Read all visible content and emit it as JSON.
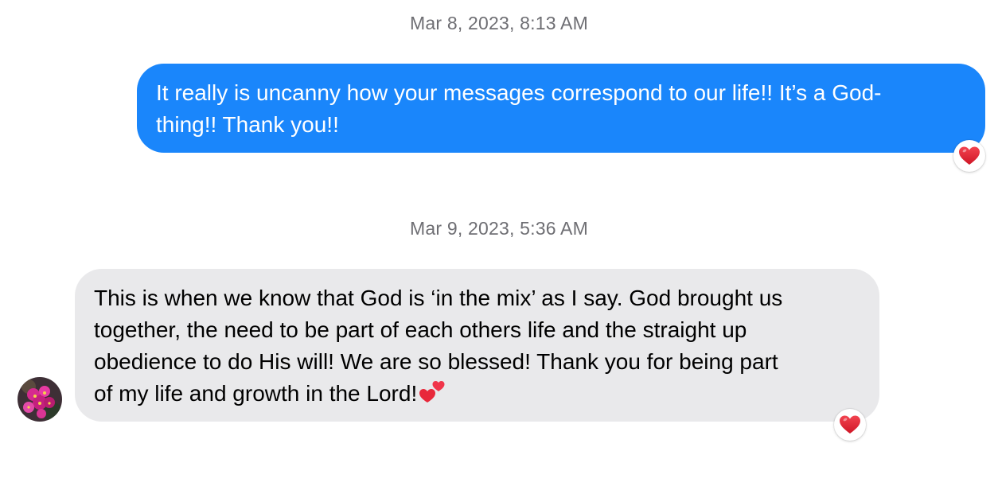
{
  "conversation": {
    "messages": [
      {
        "timestamp": "Mar 8, 2023, 8:13 AM",
        "direction": "outgoing",
        "text": "It really is uncanny how your messages correspond to our life!! It’s a God-\nthing!! Thank you!!",
        "reaction": "heart-icon"
      },
      {
        "timestamp": "Mar 9, 2023, 5:36 AM",
        "direction": "incoming",
        "text": "This is when we know that God is ‘in the mix’ as I say. God brought us\ntogether, the need to be part of each others life and the straight up\nobedience to do His will! We are so blessed! Thank you for being part\nof my life and growth in the Lord!",
        "trailing_emoji": "two-hearts-icon",
        "reaction": "heart-icon"
      }
    ]
  },
  "colors": {
    "outgoing_bubble": "#1a86fb",
    "incoming_bubble": "#e9e9eb",
    "timestamp_text": "#6e6e73",
    "reaction_heart": "#e0212f"
  }
}
